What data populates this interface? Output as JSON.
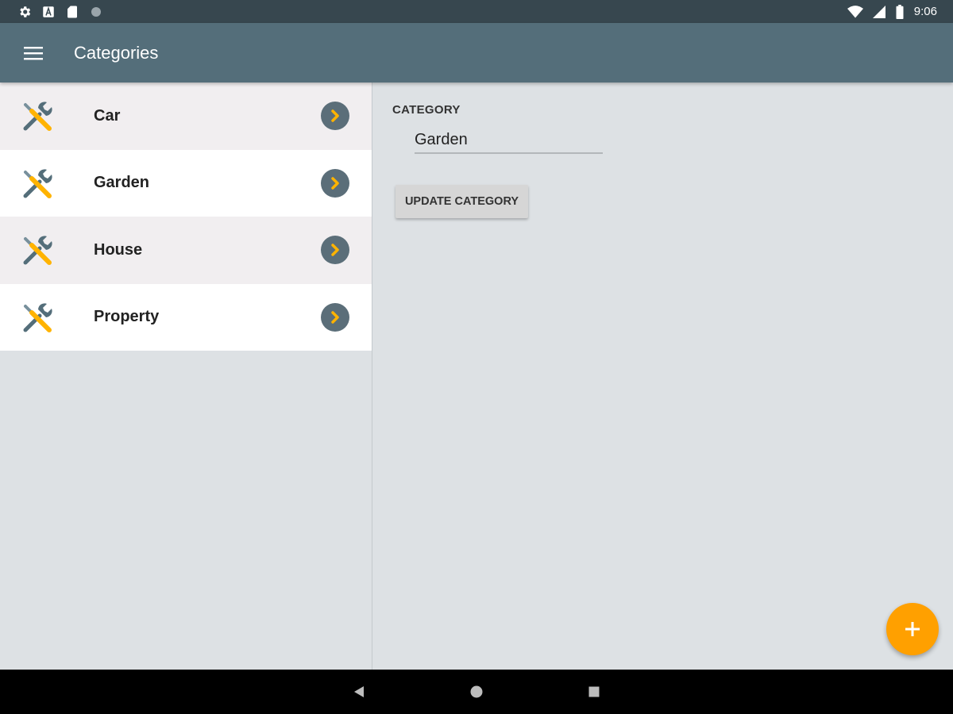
{
  "status_bar": {
    "time": "9:06",
    "left_icons": [
      "settings-icon",
      "a-notification-icon",
      "sd-card-icon",
      "circle-icon"
    ],
    "right_icons": [
      "wifi-icon",
      "signal-icon",
      "battery-icon"
    ]
  },
  "app_bar": {
    "title": "Categories",
    "menu_icon": "hamburger-menu-icon"
  },
  "categories": {
    "items": [
      {
        "label": "Car",
        "icon": "tools-icon"
      },
      {
        "label": "Garden",
        "icon": "tools-icon"
      },
      {
        "label": "House",
        "icon": "tools-icon"
      },
      {
        "label": "Property",
        "icon": "tools-icon"
      }
    ]
  },
  "detail": {
    "field_label": "CATEGORY",
    "field_value": "Garden",
    "update_button_label": "UPDATE CATEGORY"
  },
  "fab": {
    "icon": "plus-icon"
  },
  "nav_bar": {
    "icons": [
      "back-icon",
      "home-icon",
      "recents-icon"
    ]
  },
  "colors": {
    "status_bar": "#37474f",
    "app_bar": "#546e7a",
    "accent": "#ffa000",
    "chevron_circle": "#5b6e79",
    "chevron": "#ffb300",
    "background": "#dde1e4"
  }
}
